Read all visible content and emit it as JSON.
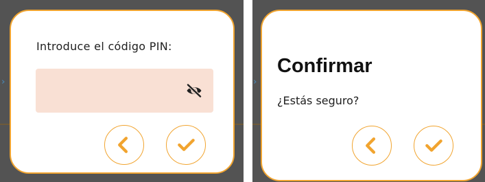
{
  "pin_dialog": {
    "label": "Introduce el código PIN:",
    "field_value": "",
    "visibility_icon": "eye-off-icon",
    "back_icon": "chevron-left-icon",
    "confirm_icon": "check-icon"
  },
  "confirm_dialog": {
    "title": "Confirmar",
    "message": "¿Estás seguro?",
    "back_icon": "chevron-left-icon",
    "confirm_icon": "check-icon"
  },
  "colors": {
    "accent": "#f1a42f",
    "field_background": "#f9e0d4",
    "backdrop": "#535353",
    "text": "#1e1e1e"
  }
}
